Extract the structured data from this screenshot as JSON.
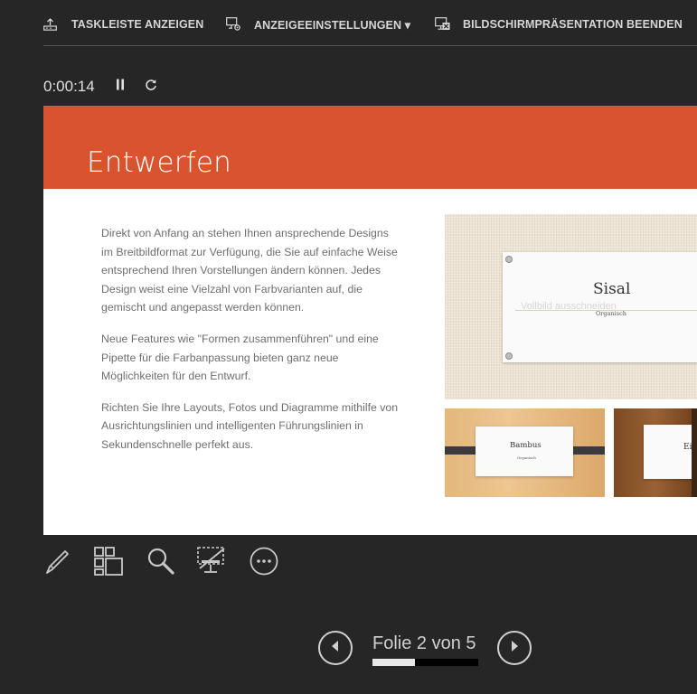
{
  "toolbar": {
    "taskbar_label": "TASKLEISTE ANZEIGEN",
    "display_settings_label": "ANZEIGEEINSTELLUNGEN ▾",
    "end_show_label": "BILDSCHIRMPRÄSENTATION BEENDEN"
  },
  "timer": {
    "elapsed": "0:00:14"
  },
  "slide": {
    "title": "Entwerfen",
    "accent_color": "#d9532f",
    "paragraphs": [
      "Direkt von Anfang an stehen Ihnen ansprechende Designs im Breitbildformat zur Verfügung, die Sie auf einfache Weise entsprechend Ihren Vorstellungen ändern können.  Jedes Design weist eine Vielzahl von Farbvarianten auf, die gemischt und angepasst werden können.",
      "Neue Features wie \"Formen zusammenführen\" und eine Pipette für die Farbanpassung bieten ganz neue Möglichkeiten für den Entwurf.",
      "Richten Sie Ihre Layouts, Fotos und Diagramme mithilfe von Ausrichtungslinien und intelligenten Führungslinien in Sekundenschnelle perfekt aus."
    ],
    "thumbnails": {
      "main": {
        "title": "Sisal",
        "subtitle": "Organisch",
        "ghost_text": "Vollbild ausschneiden"
      },
      "bamboo": {
        "title": "Bambus",
        "subtitle": "Organisch"
      },
      "oak": {
        "title": "Eic"
      }
    }
  },
  "tools": [
    "pen-icon",
    "slides-grid-icon",
    "zoom-icon",
    "screen-display-icon",
    "more-options-icon"
  ],
  "navigation": {
    "slide_label": "Folie 2 von 5",
    "current_slide": 2,
    "total_slides": 5,
    "progress_fraction": 0.4
  }
}
